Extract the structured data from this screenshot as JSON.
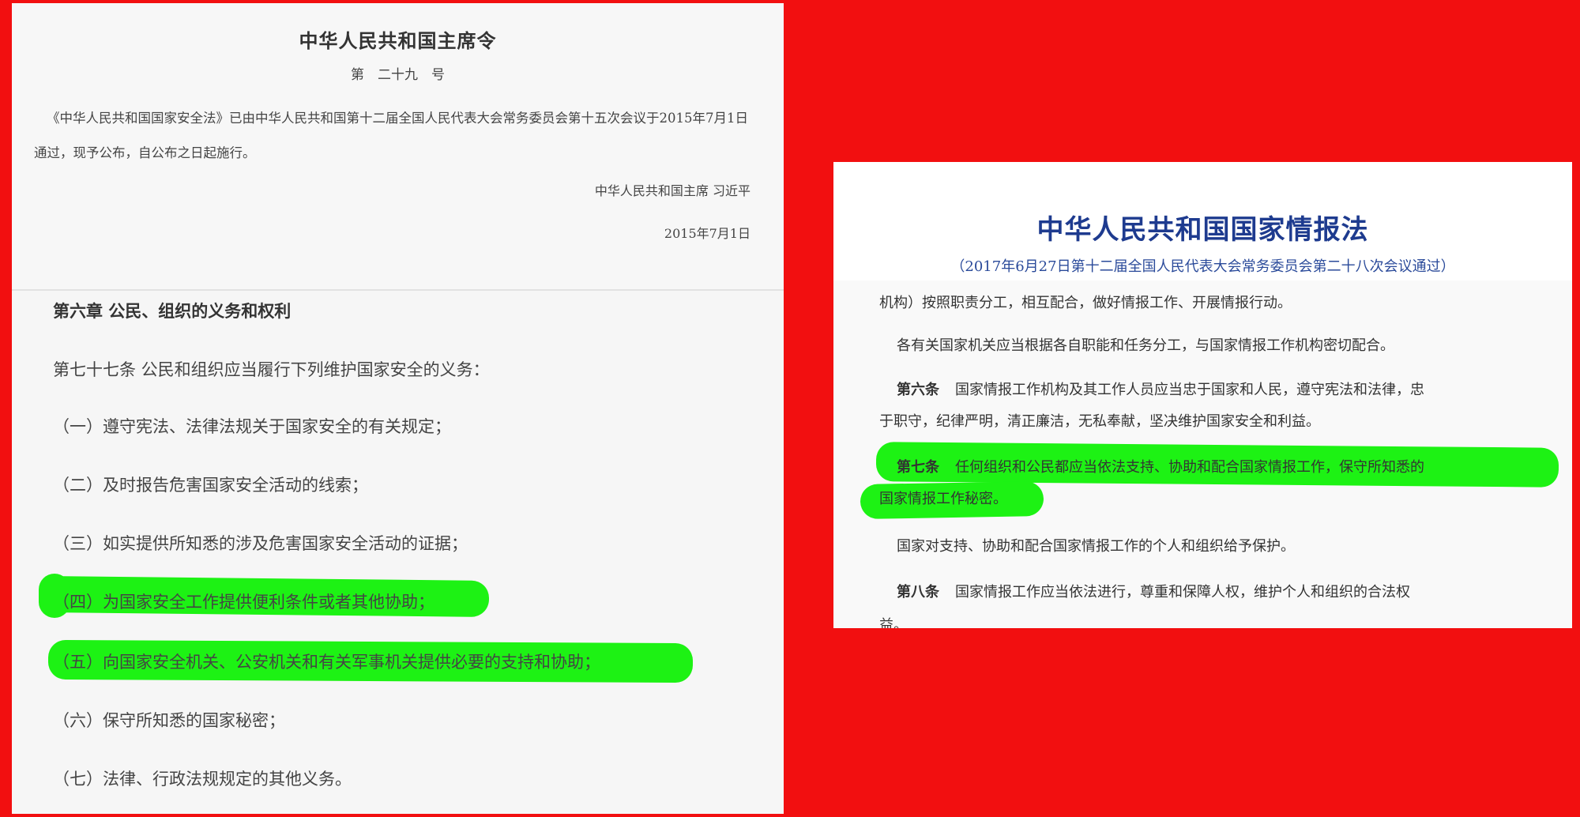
{
  "left": {
    "decree_title": "中华人民共和国主席令",
    "decree_number": "第　二十九　号",
    "decree_body": "《中华人民共和国国家安全法》已由中华人民共和国第十二届全国人民代表大会常务委员会第十五次会议于2015年7月1日通过，现予公布，自公布之日起施行。",
    "signer": "中华人民共和国主席 习近平",
    "date": "2015年7月1日",
    "chapter_title": "第六章 公民、组织的义务和权利",
    "article_77": "第七十七条 公民和组织应当履行下列维护国家安全的义务：",
    "duties": [
      "（一）遵守宪法、法律法规关于国家安全的有关规定；",
      "（二）及时报告危害国家安全活动的线索；",
      "（三）如实提供所知悉的涉及危害国家安全活动的证据；",
      "（四）为国家安全工作提供便利条件或者其他协助；",
      "（五）向国家安全机关、公安机关和有关军事机关提供必要的支持和协助；",
      "（六）保守所知悉的国家秘密；",
      "（七）法律、行政法规规定的其他义务。"
    ],
    "highlighted_duties": [
      3,
      4
    ]
  },
  "right": {
    "law_title": "中华人民共和国国家情报法",
    "law_subtitle": "（2017年6月27日第十二届全国人民代表大会常务委员会第二十八次会议通过）",
    "line_1": "机构）按照职责分工，相互配合，做好情报工作、开展情报行动。",
    "line_2": "各有关国家机关应当根据各自职能和任务分工，与国家情报工作机构密切配合。",
    "art6_label": "第六条",
    "art6_line1": "国家情报工作机构及其工作人员应当忠于国家和人民，遵守宪法和法律，忠",
    "art6_line2": "于职守，纪律严明，清正廉洁，无私奉献，坚决维护国家安全和利益。",
    "art7_label": "第七条",
    "art7_line1": "任何组织和公民都应当依法支持、协助和配合国家情报工作，保守所知悉的",
    "art7_line2": "国家情报工作秘密。",
    "line_protect": "国家对支持、协助和配合国家情报工作的个人和组织给予保护。",
    "art8_label": "第八条",
    "art8_line1": "国家情报工作应当依法进行，尊重和保障人权，维护个人和组织的合法权",
    "art8_line2": "益。"
  },
  "colors": {
    "background": "#f20f10",
    "highlight": "#1df214",
    "title_blue": "#1e3b8f"
  }
}
